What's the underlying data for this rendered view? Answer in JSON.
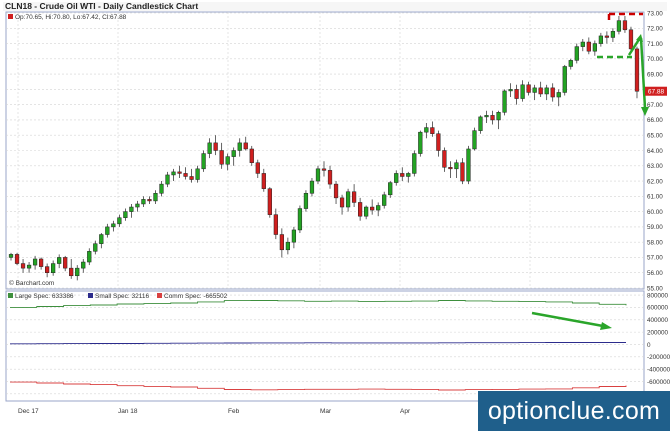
{
  "header": {
    "title": "CLN18 - Crude Oil WTI - Daily Candlestick Chart",
    "ohlc": "Op:70.65, Hi:70.80, Lo:67.42, Cl:67.88"
  },
  "watermark": {
    "text": "optionclue.com"
  },
  "attribution": "© Barchart.com",
  "price_panel": {
    "last_price_label": "67.88",
    "tick_labels": [
      "55.00",
      "56.00",
      "57.00",
      "58.00",
      "59.00",
      "60.00",
      "61.00",
      "62.00",
      "63.00",
      "64.00",
      "65.00",
      "66.00",
      "67.00",
      "68.00",
      "69.00",
      "70.00",
      "71.00",
      "72.00",
      "73.00"
    ]
  },
  "cot_panel": {
    "tick_labels": [
      "800000",
      "600000",
      "400000",
      "200000",
      "0",
      "-200000",
      "-400000",
      "-600000",
      "-800000"
    ]
  },
  "x_tick_labels": [
    "Dec 17",
    "Jan 18",
    "Feb",
    "Mar",
    "Apr",
    "May"
  ],
  "colors": {
    "up_candle": "#23a323",
    "down_candle": "#d01f1f",
    "large_spec": "#3d8f3d",
    "small_spec": "#2c2c8c",
    "comm_spec": "#d94040",
    "grid": "#d4d4d4",
    "annotation_red": "#cc0000",
    "annotation_green": "#2aa52a",
    "watermark_bg": "#1f5f8b"
  },
  "chart_data": [
    {
      "type": "candlestick",
      "title": "CLN18 - Crude Oil WTI - Daily Candlestick Chart",
      "ylim": [
        55,
        73
      ],
      "x_labels": [
        "Dec 17",
        "Jan 18",
        "Feb",
        "Mar",
        "Apr",
        "May"
      ],
      "last": {
        "open": 70.65,
        "high": 70.8,
        "low": 67.42,
        "close": 67.88
      },
      "candles": [
        [
          57.0,
          57.3,
          56.8,
          57.2
        ],
        [
          57.2,
          57.3,
          56.5,
          56.6
        ],
        [
          56.6,
          56.9,
          56.0,
          56.3
        ],
        [
          56.3,
          56.7,
          56.0,
          56.5
        ],
        [
          56.5,
          57.1,
          56.2,
          56.9
        ],
        [
          56.9,
          57.0,
          56.2,
          56.4
        ],
        [
          56.4,
          56.6,
          55.7,
          56.0
        ],
        [
          56.0,
          56.8,
          55.8,
          56.6
        ],
        [
          56.6,
          57.2,
          56.3,
          57.0
        ],
        [
          57.0,
          57.1,
          56.1,
          56.3
        ],
        [
          56.3,
          56.9,
          55.6,
          55.8
        ],
        [
          55.8,
          56.5,
          55.5,
          56.3
        ],
        [
          56.3,
          56.9,
          56.0,
          56.7
        ],
        [
          56.7,
          57.6,
          56.5,
          57.4
        ],
        [
          57.4,
          58.1,
          57.2,
          57.9
        ],
        [
          57.9,
          58.6,
          57.6,
          58.5
        ],
        [
          58.5,
          59.2,
          58.3,
          59.0
        ],
        [
          59.0,
          59.4,
          58.7,
          59.2
        ],
        [
          59.2,
          59.8,
          59.0,
          59.6
        ],
        [
          59.6,
          60.2,
          59.4,
          60.0
        ],
        [
          60.0,
          60.5,
          59.6,
          60.3
        ],
        [
          60.3,
          60.7,
          60.0,
          60.5
        ],
        [
          60.5,
          61.0,
          60.3,
          60.8
        ],
        [
          60.8,
          61.0,
          60.5,
          60.7
        ],
        [
          60.7,
          61.4,
          60.5,
          61.2
        ],
        [
          61.2,
          62.0,
          61.0,
          61.8
        ],
        [
          61.8,
          62.6,
          61.6,
          62.4
        ],
        [
          62.4,
          62.8,
          62.0,
          62.6
        ],
        [
          62.6,
          63.0,
          62.2,
          62.5
        ],
        [
          62.5,
          62.9,
          62.1,
          62.3
        ],
        [
          62.3,
          62.8,
          61.9,
          62.1
        ],
        [
          62.1,
          63.0,
          61.9,
          62.8
        ],
        [
          62.8,
          64.0,
          62.6,
          63.8
        ],
        [
          63.8,
          64.8,
          63.5,
          64.5
        ],
        [
          64.5,
          65.0,
          63.7,
          64.0
        ],
        [
          64.0,
          64.5,
          62.8,
          63.1
        ],
        [
          63.1,
          63.8,
          62.7,
          63.6
        ],
        [
          63.6,
          64.2,
          63.0,
          64.0
        ],
        [
          64.0,
          64.8,
          63.6,
          64.5
        ],
        [
          64.5,
          64.9,
          64.0,
          64.1
        ],
        [
          64.1,
          64.3,
          63.0,
          63.2
        ],
        [
          63.2,
          63.4,
          62.2,
          62.5
        ],
        [
          62.5,
          62.8,
          61.3,
          61.5
        ],
        [
          61.5,
          61.6,
          59.6,
          59.8
        ],
        [
          59.8,
          60.2,
          58.2,
          58.5
        ],
        [
          58.5,
          58.9,
          57.0,
          57.5
        ],
        [
          57.5,
          58.3,
          57.2,
          58.0
        ],
        [
          58.0,
          59.0,
          57.6,
          58.8
        ],
        [
          58.8,
          60.4,
          58.6,
          60.2
        ],
        [
          60.2,
          61.4,
          60.0,
          61.2
        ],
        [
          61.2,
          62.2,
          61.0,
          62.0
        ],
        [
          62.0,
          63.0,
          61.8,
          62.8
        ],
        [
          62.8,
          63.3,
          62.3,
          62.7
        ],
        [
          62.7,
          63.0,
          61.5,
          61.8
        ],
        [
          61.8,
          62.0,
          60.5,
          60.9
        ],
        [
          60.9,
          61.1,
          59.8,
          60.3
        ],
        [
          60.3,
          61.5,
          60.0,
          61.3
        ],
        [
          61.3,
          61.8,
          60.3,
          60.6
        ],
        [
          60.6,
          60.9,
          59.4,
          59.7
        ],
        [
          59.7,
          60.4,
          59.5,
          60.3
        ],
        [
          60.3,
          60.8,
          59.8,
          60.1
        ],
        [
          60.1,
          60.6,
          59.7,
          60.4
        ],
        [
          60.4,
          61.3,
          60.2,
          61.1
        ],
        [
          61.1,
          62.0,
          60.9,
          61.9
        ],
        [
          61.9,
          62.7,
          61.7,
          62.5
        ],
        [
          62.5,
          62.9,
          62.0,
          62.3
        ],
        [
          62.3,
          62.6,
          61.9,
          62.5
        ],
        [
          62.5,
          64.0,
          62.3,
          63.8
        ],
        [
          63.8,
          65.3,
          63.6,
          65.2
        ],
        [
          65.2,
          65.8,
          64.8,
          65.5
        ],
        [
          65.5,
          65.9,
          64.9,
          65.1
        ],
        [
          65.1,
          65.3,
          63.6,
          64.0
        ],
        [
          64.0,
          64.2,
          62.6,
          62.9
        ],
        [
          62.9,
          63.3,
          62.2,
          62.8
        ],
        [
          62.8,
          63.4,
          62.2,
          63.2
        ],
        [
          63.2,
          63.5,
          61.8,
          62.0
        ],
        [
          62.0,
          64.3,
          61.8,
          64.1
        ],
        [
          64.1,
          65.5,
          64.0,
          65.3
        ],
        [
          65.3,
          66.3,
          65.1,
          66.2
        ],
        [
          66.2,
          66.6,
          65.8,
          66.3
        ],
        [
          66.3,
          66.6,
          65.7,
          66.0
        ],
        [
          66.0,
          66.6,
          65.4,
          66.5
        ],
        [
          66.5,
          68.0,
          66.3,
          67.9
        ],
        [
          67.9,
          68.4,
          67.5,
          68.0
        ],
        [
          68.0,
          68.3,
          67.0,
          67.4
        ],
        [
          67.4,
          68.6,
          67.2,
          68.3
        ],
        [
          68.3,
          68.5,
          67.6,
          67.8
        ],
        [
          67.8,
          68.3,
          67.3,
          68.1
        ],
        [
          68.1,
          68.5,
          67.5,
          67.7
        ],
        [
          67.7,
          68.3,
          67.3,
          68.1
        ],
        [
          68.1,
          68.4,
          67.2,
          67.5
        ],
        [
          67.5,
          68.0,
          66.9,
          67.8
        ],
        [
          67.8,
          69.6,
          67.6,
          69.5
        ],
        [
          69.5,
          70.0,
          69.3,
          69.9
        ],
        [
          69.9,
          71.0,
          69.7,
          70.8
        ],
        [
          70.8,
          71.3,
          70.5,
          71.1
        ],
        [
          71.1,
          71.4,
          70.3,
          70.5
        ],
        [
          70.5,
          71.2,
          70.2,
          71.0
        ],
        [
          71.0,
          71.7,
          70.8,
          71.5
        ],
        [
          71.5,
          71.8,
          71.0,
          71.4
        ],
        [
          71.4,
          72.0,
          71.1,
          71.8
        ],
        [
          71.8,
          72.8,
          71.6,
          72.5
        ],
        [
          72.5,
          72.8,
          71.7,
          71.9
        ],
        [
          71.9,
          72.1,
          70.5,
          70.65
        ],
        [
          70.65,
          70.8,
          67.42,
          67.88
        ]
      ]
    },
    {
      "type": "line",
      "title": "COT positions",
      "ylim": [
        -900000,
        850000
      ],
      "x_labels": [
        "Dec 17",
        "Jan 18",
        "Feb",
        "Mar",
        "Apr",
        "May"
      ],
      "series": [
        {
          "name": "Large Spec",
          "label": "Large Spec: 633386",
          "values": [
            600000,
            615000,
            630000,
            640000,
            655000,
            662000,
            672000,
            690000,
            710000,
            712000,
            708000,
            700000,
            702000,
            698000,
            700000,
            702000,
            712000,
            705000,
            700000,
            695000,
            690000,
            672000,
            650000,
            633386
          ]
        },
        {
          "name": "Small Spec",
          "label": "Small Spec: 32116",
          "values": [
            10000,
            12000,
            14000,
            15000,
            16000,
            18000,
            20000,
            22000,
            24000,
            25000,
            26000,
            27000,
            26000,
            25000,
            25000,
            25000,
            27000,
            28000,
            29000,
            30000,
            31000,
            32000,
            32000,
            32116
          ]
        },
        {
          "name": "Comm Spec",
          "label": "Comm Spec: -665502",
          "values": [
            -610000,
            -625000,
            -640000,
            -650000,
            -668000,
            -680000,
            -690000,
            -710000,
            -730000,
            -735000,
            -732000,
            -727000,
            -726000,
            -724000,
            -726000,
            -728000,
            -738000,
            -732000,
            -728000,
            -724000,
            -720000,
            -702000,
            -682000,
            -665502
          ]
        }
      ]
    }
  ]
}
